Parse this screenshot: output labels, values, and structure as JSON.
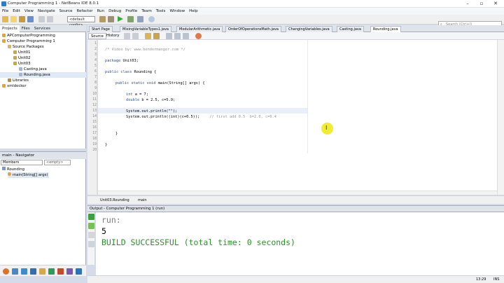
{
  "window": {
    "title": "Computer Programming 1 - NetBeans IDE 8.0.1",
    "controls": [
      "–",
      "▫",
      "✕"
    ]
  },
  "menu": [
    "File",
    "Edit",
    "View",
    "Navigate",
    "Source",
    "Refactor",
    "Run",
    "Debug",
    "Profile",
    "Team",
    "Tools",
    "Window",
    "Help"
  ],
  "toolbar": {
    "config": "<default config>"
  },
  "search": {
    "placeholder": "Search (Ctrl+I)"
  },
  "project_panel": {
    "tabs": [
      "Projects",
      "Files",
      "Services"
    ],
    "tree": [
      "APComputerProgramming",
      "Computer Programming 1",
      "Source Packages",
      "Unit01",
      "Unit02",
      "Unit03",
      "Casting.java",
      "Rounding.java",
      "Libraries",
      "xmldecker"
    ]
  },
  "navigator": {
    "title": "main - Navigator",
    "members": "Members",
    "empty": "<empty>",
    "class": "Rounding",
    "method": "main(String[] args)"
  },
  "editor": {
    "tabs": [
      "Start Page",
      "MixingVariableTypes1.java",
      "ModularArithmetic.java",
      "OrderOfOperationsMath.java",
      "ChangingVariables.java",
      "Casting.java",
      "Rounding.java"
    ],
    "source_tab": "Source",
    "history_tab": "History",
    "line_numbers": [
      "1",
      "2",
      "3",
      "4",
      "5",
      "6",
      "7",
      "8",
      "9",
      "10",
      "11",
      "12",
      "13",
      "14",
      "15",
      "16",
      "17",
      "18",
      "19",
      "20"
    ],
    "code": {
      "l2": "/* Video by: www.bendermanger.com */",
      "l4_kw": "package",
      "l4": " Unit03;",
      "l6_kw": "public class",
      "l6": " Rounding {",
      "l8_kw": "public static void",
      "l8": " main(String[] args) {",
      "l10_kw": "int",
      "l10": " a = 7;",
      "l11_kw": "double",
      "l11": " b = 2.5, c=5.9;",
      "l13": "System.out.println(\"\");",
      "l14": "System.out.println((int)(c+0.5));",
      "l14_comment": "// first add 0.5  b=2.0, c=6.4",
      "l16": "}",
      "l18": "}"
    },
    "breadcrumb": [
      "Unit03.Rounding",
      "main"
    ]
  },
  "output": {
    "title": "Output - Computer Programming 1 (run)",
    "lines": [
      "run:",
      "5",
      "BUILD SUCCESSFUL (total time: 0 seconds)"
    ]
  },
  "status": {
    "time": "13:29",
    "mode": "INS"
  }
}
